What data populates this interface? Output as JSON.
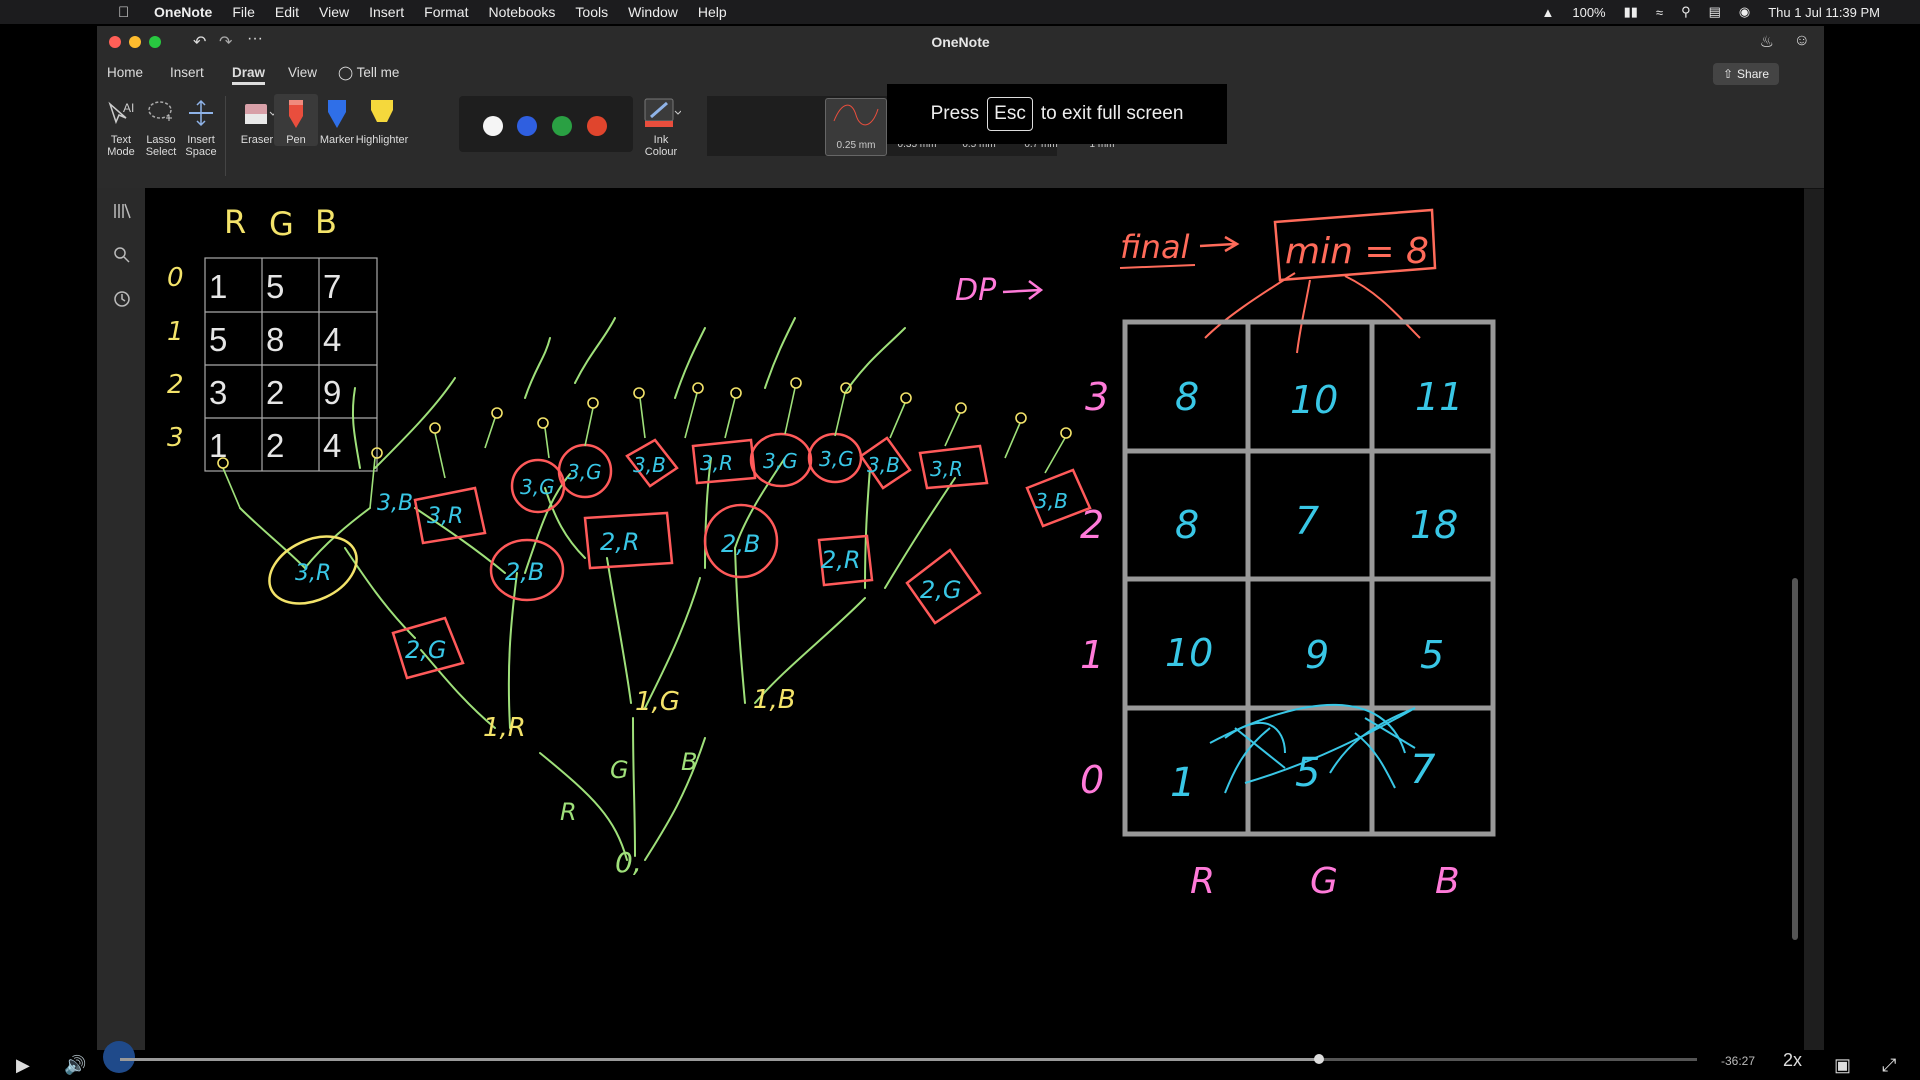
{
  "menubar": {
    "app_name": "OneNote",
    "items": [
      "File",
      "Edit",
      "View",
      "Insert",
      "Format",
      "Notebooks",
      "Tools",
      "Window",
      "Help"
    ],
    "battery": "100%",
    "datetime": "Thu 1 Jul  11:39 PM"
  },
  "window": {
    "title": "OneNote",
    "more": "···"
  },
  "ribbon_tabs": [
    "Home",
    "Insert",
    "Draw",
    "View"
  ],
  "tell_me": "Tell me",
  "share_label": "Share",
  "tools": {
    "text_mode": "Text Mode",
    "lasso_select": "Lasso Select",
    "insert_space": "Insert Space",
    "eraser": "Eraser",
    "pen": "Pen",
    "marker": "Marker",
    "highlighter": "Highlighter",
    "ink_colour": "Ink Colour"
  },
  "colors": [
    "#f5f5f5",
    "#2f5fe0",
    "#2aa043",
    "#e0452d"
  ],
  "thicknesses": [
    "0.25 mm",
    "0.35 mm",
    "0.5 mm",
    "0.7 mm",
    "1 mm"
  ],
  "selected_thickness": "0.25 mm",
  "fullscreen_banner": {
    "press": "Press",
    "key": "Esc",
    "rest": "to exit full screen"
  },
  "drawing": {
    "table_headers": [
      "R",
      "G",
      "B"
    ],
    "table_row_labels": [
      "0",
      "1",
      "2",
      "3"
    ],
    "table_values": [
      [
        "1",
        "5",
        "7"
      ],
      [
        "5",
        "8",
        "4"
      ],
      [
        "3",
        "2",
        "9"
      ],
      [
        "1",
        "2",
        "4"
      ]
    ],
    "dp_label": "DP",
    "final_label": "final",
    "min_label": "min = 8",
    "dp_row_labels": [
      "3",
      "2",
      "1",
      "0"
    ],
    "dp_values": [
      [
        "8",
        "10",
        "11"
      ],
      [
        "8",
        "7",
        "18"
      ],
      [
        "10",
        "9",
        "5"
      ],
      [
        "1",
        "5",
        "7"
      ]
    ],
    "dp_col_labels": [
      "R",
      "G",
      "B"
    ],
    "tree_root": "0,",
    "tree_nodes_level1": [
      "1,R",
      "1,G",
      "1,B"
    ],
    "tree_nodes_level2": [
      "2,G",
      "2,B",
      "2,R",
      "2,B",
      "2,R",
      "2,G"
    ],
    "tree_nodes_level3": [
      "3,R",
      "3,B",
      "3,R",
      "3,G",
      "3,G",
      "3,B",
      "3,R",
      "3,G",
      "3,G",
      "3,B",
      "3,R",
      "3,B"
    ],
    "branch_labels": [
      "R",
      "G",
      "B"
    ]
  },
  "player": {
    "remaining": "-36:27",
    "speed": "2x",
    "progress": 0.76
  }
}
